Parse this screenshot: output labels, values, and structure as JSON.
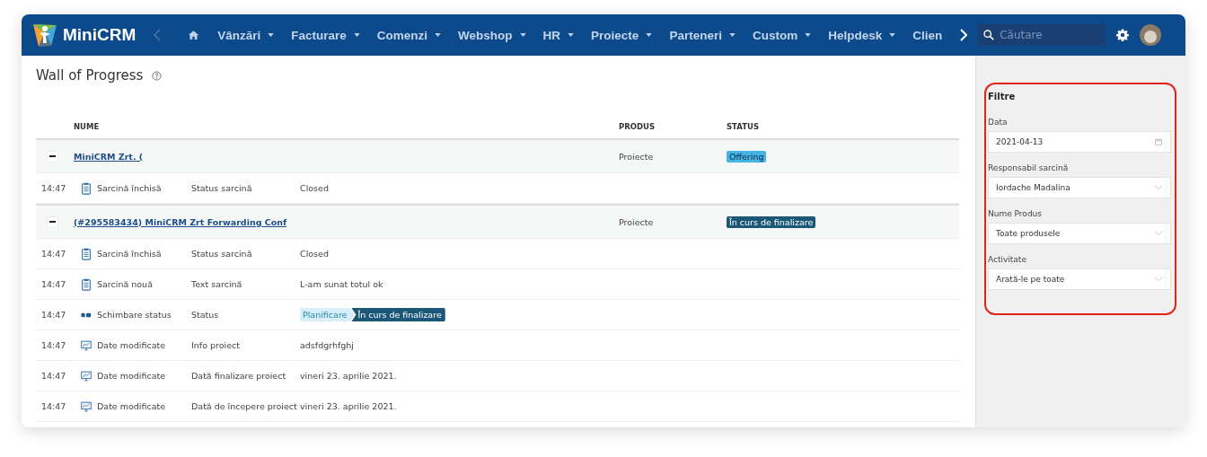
{
  "brand": "MiniCRM",
  "nav": [
    {
      "label": "Vânzări",
      "dropdown": true
    },
    {
      "label": "Facturare",
      "dropdown": true
    },
    {
      "label": "Comenzi",
      "dropdown": true
    },
    {
      "label": "Webshop",
      "dropdown": true
    },
    {
      "label": "HR",
      "dropdown": true
    },
    {
      "label": "Proiecte",
      "dropdown": true
    },
    {
      "label": "Parteneri",
      "dropdown": true
    },
    {
      "label": "Custom",
      "dropdown": true
    },
    {
      "label": "Helpdesk",
      "dropdown": true
    },
    {
      "label": "Clien",
      "dropdown": false
    }
  ],
  "search": {
    "placeholder": "Căutare"
  },
  "page_title": "Wall of Progress",
  "columns": [
    "NUME",
    "PRODUS",
    "STATUS"
  ],
  "rows": [
    {
      "kind": "group",
      "expanded": true,
      "name": "MiniCRM Zrt. (",
      "product": "Proiecte",
      "status": {
        "label": "Offering",
        "color": "#45b4e4"
      }
    },
    {
      "kind": "task",
      "time": "14:47",
      "event": "Sarcină închisă",
      "field": "Status sarcină",
      "value": "Closed"
    },
    {
      "kind": "group",
      "expanded": true,
      "name": "(#295583434) MiniCRM Zrt Forwarding Conf",
      "product": "Proiecte",
      "status": {
        "label": "În curs de finalizare",
        "color": "#1b5878"
      }
    },
    {
      "kind": "task",
      "time": "14:47",
      "event": "Sarcină închisă",
      "field": "Status sarcină",
      "value": "Closed"
    },
    {
      "kind": "task",
      "time": "14:47",
      "event": "Sarcină nouă",
      "field": "Text sarcină",
      "value": "L-am sunat totul ok"
    },
    {
      "kind": "status_change",
      "time": "14:47",
      "event": "Schimbare status",
      "field": "Status",
      "from": "Planificare",
      "to": "În curs de finalizare"
    },
    {
      "kind": "data_change",
      "time": "14:47",
      "event": "Date modificate",
      "field": "Info proiect",
      "value": "adsfdgrhfghj"
    },
    {
      "kind": "data_change",
      "time": "14:47",
      "event": "Date modificate",
      "field": "Dată finalizare proiect",
      "value": "vineri 23. aprilie 2021."
    },
    {
      "kind": "data_change",
      "time": "14:47",
      "event": "Date modificate",
      "field": "Dată de începere proiect",
      "value": "vineri 23. aprilie 2021."
    }
  ],
  "filters": {
    "title": "Filtre",
    "highlighted": true,
    "fields": [
      {
        "kind": "date",
        "label": "Data",
        "value": "2021-04-13"
      },
      {
        "kind": "select",
        "label": "Responsabil sarcină",
        "value": "Iordache Madalina"
      },
      {
        "kind": "select",
        "label": "Nume Produs",
        "value": "Toate produsele"
      },
      {
        "kind": "select",
        "label": "Activitate",
        "value": "Arată-le pe toate"
      }
    ]
  }
}
